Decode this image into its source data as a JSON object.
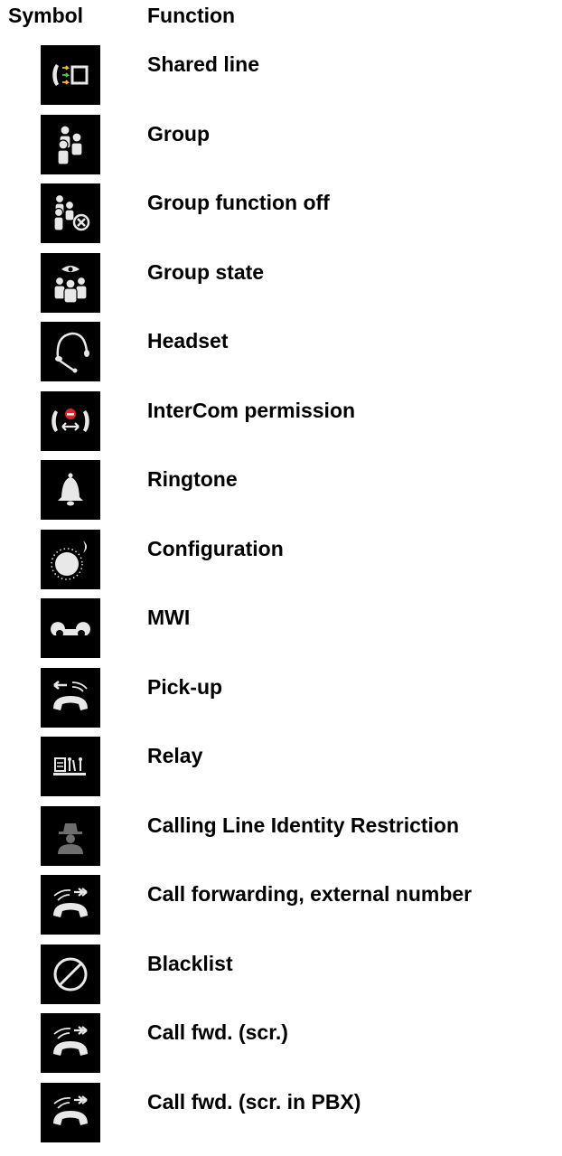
{
  "header": {
    "symbol": "Symbol",
    "function": "Function"
  },
  "rows": [
    {
      "icon": "shared-line-icon",
      "label": "Shared line"
    },
    {
      "icon": "group-icon",
      "label": "Group"
    },
    {
      "icon": "group-function-off-icon",
      "label": "Group function off"
    },
    {
      "icon": "group-state-icon",
      "label": "Group state"
    },
    {
      "icon": "headset-icon",
      "label": "Headset"
    },
    {
      "icon": "intercom-permission-icon",
      "label": "InterCom permission"
    },
    {
      "icon": "ringtone-bell-icon",
      "label": "Ringtone"
    },
    {
      "icon": "configuration-icon",
      "label": "Configuration"
    },
    {
      "icon": "mwi-voicemail-icon",
      "label": "MWI"
    },
    {
      "icon": "pick-up-icon",
      "label": "Pick-up"
    },
    {
      "icon": "relay-icon",
      "label": "Relay"
    },
    {
      "icon": "clir-incognito-icon",
      "label": "Calling Line Identity Restriction"
    },
    {
      "icon": "call-forwarding-icon",
      "label": "Call forwarding, external number"
    },
    {
      "icon": "blacklist-icon",
      "label": "Blacklist"
    },
    {
      "icon": "call-forwarding-icon",
      "label": "Call fwd. (scr.)"
    },
    {
      "icon": "call-forwarding-icon",
      "label": "Call fwd. (scr. in PBX)"
    }
  ],
  "colors": {
    "icon_background": "#000000",
    "icon_foreground": "#e8e8e8",
    "shared_line_arrow_green": "#4cd137",
    "shared_line_arrow_yellow": "#f5c400",
    "intercom_red": "#e0202a"
  }
}
